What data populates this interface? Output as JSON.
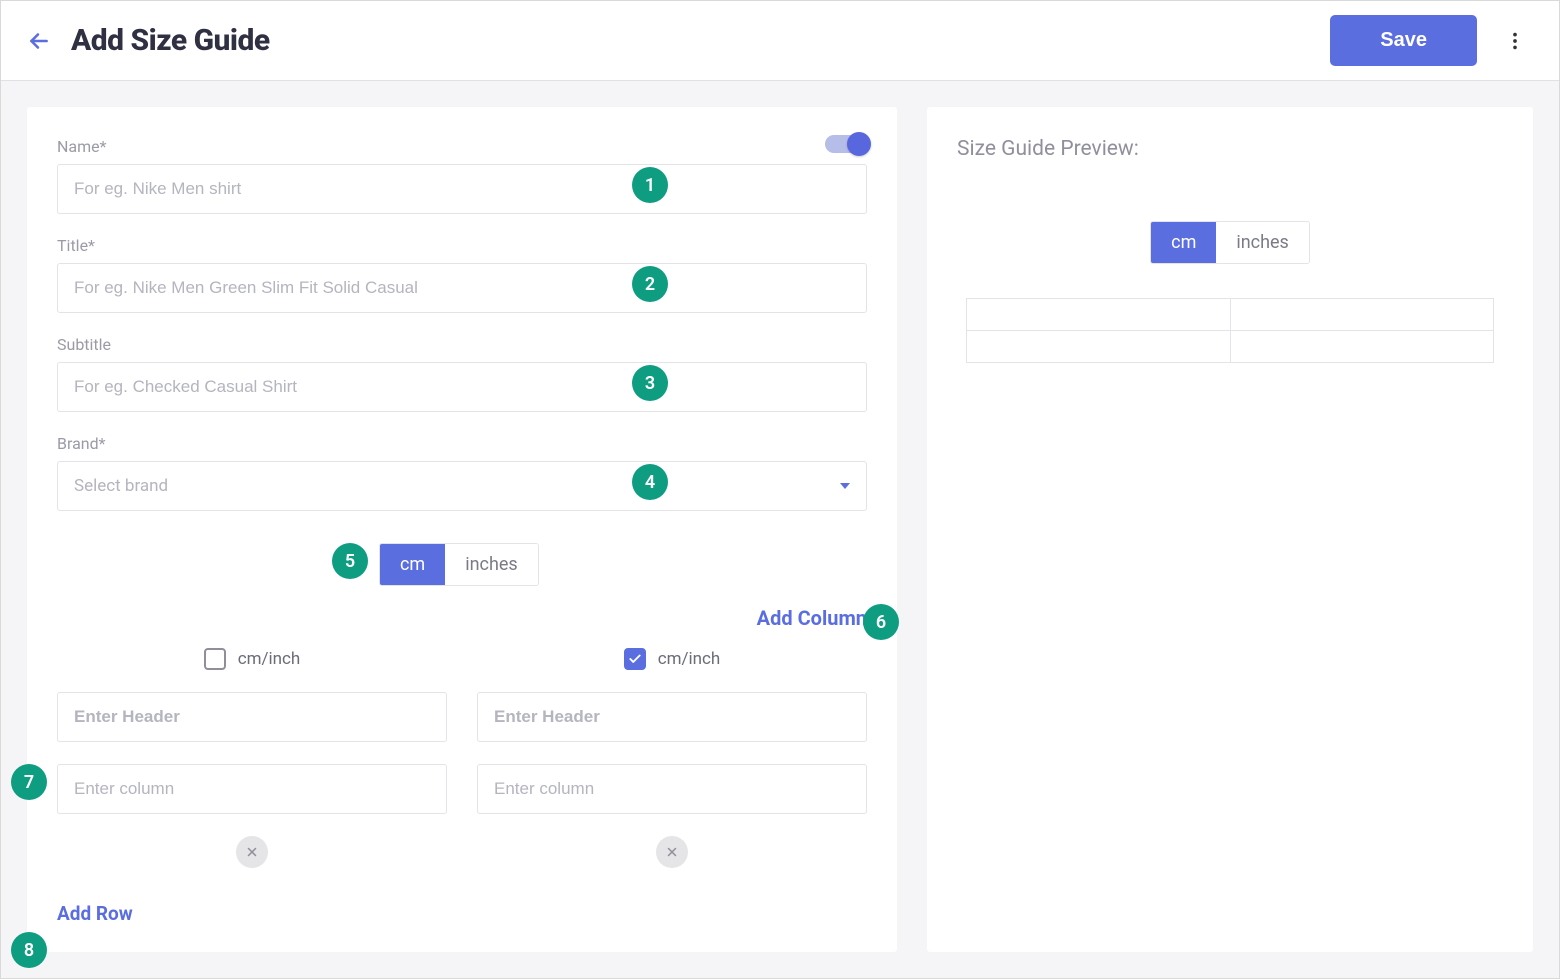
{
  "header": {
    "title": "Add Size Guide",
    "save_label": "Save"
  },
  "form": {
    "toggle_on": true,
    "name": {
      "label": "Name*",
      "placeholder": "For eg. Nike Men shirt",
      "value": ""
    },
    "title": {
      "label": "Title*",
      "placeholder": "For eg. Nike Men Green Slim Fit Solid Casual",
      "value": ""
    },
    "subtitle": {
      "label": "Subtitle",
      "placeholder": "For eg. Checked Casual Shirt",
      "value": ""
    },
    "brand": {
      "label": "Brand*",
      "placeholder": "Select brand"
    },
    "units": {
      "cm": "cm",
      "inches": "inches",
      "active": "cm"
    },
    "add_column_label": "Add Column",
    "add_row_label": "Add Row",
    "columns": [
      {
        "cm_inch_label": "cm/inch",
        "checked": false,
        "header_placeholder": "Enter Header",
        "cell_placeholder": "Enter column"
      },
      {
        "cm_inch_label": "cm/inch",
        "checked": true,
        "header_placeholder": "Enter Header",
        "cell_placeholder": "Enter column"
      }
    ]
  },
  "preview": {
    "heading": "Size Guide Preview:",
    "units": {
      "cm": "cm",
      "inches": "inches",
      "active": "cm"
    }
  },
  "badges": {
    "b1": "1",
    "b2": "2",
    "b3": "3",
    "b4": "4",
    "b5": "5",
    "b6": "6",
    "b7": "7",
    "b8": "8"
  }
}
